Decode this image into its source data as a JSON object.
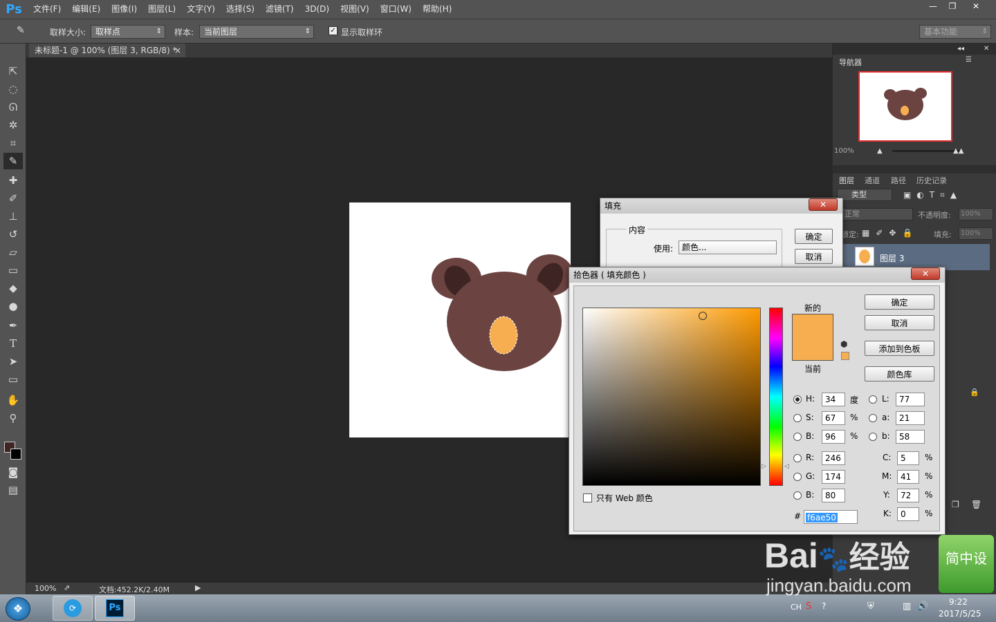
{
  "app": {
    "logo": "Ps"
  },
  "menu": [
    "文件(F)",
    "编辑(E)",
    "图像(I)",
    "图层(L)",
    "文字(Y)",
    "选择(S)",
    "滤镜(T)",
    "3D(D)",
    "视图(V)",
    "窗口(W)",
    "帮助(H)"
  ],
  "window_buttons": {
    "minimize": "—",
    "restore": "❐",
    "close": "✕"
  },
  "options": {
    "sample_size_label": "取样大小:",
    "sample_size_value": "取样点",
    "sample_label": "样本:",
    "sample_value": "当前图层",
    "show_ring_label": "显示取样环",
    "workspace_value": "基本功能"
  },
  "doc_tab": {
    "title": "未标题-1 @ 100% (图层 3, RGB/8) *",
    "close": "×"
  },
  "status": {
    "zoom": "100%",
    "doc_info": "文档:452.2K/2.40M"
  },
  "navigator": {
    "title": "导航器",
    "zoom": "100%"
  },
  "layers_panel": {
    "tabs": [
      "图层",
      "通道",
      "路径",
      "历史记录"
    ],
    "filter_label": "类型",
    "blend_mode": "正常",
    "opacity_label": "不透明度:",
    "opacity_value": "100%",
    "lock_label": "锁定:",
    "fill_label": "填充:",
    "fill_value": "100%",
    "layer_name": "图层 3"
  },
  "fill_dialog": {
    "title": "填充",
    "content_group": "内容",
    "use_label": "使用:",
    "use_value": "颜色...",
    "ok": "确定",
    "cancel": "取消"
  },
  "color_picker": {
    "title": "拾色器 ( 填充颜色 )",
    "new_label": "新的",
    "current_label": "当前",
    "ok": "确定",
    "cancel": "取消",
    "add_swatch": "添加到色板",
    "color_library": "颜色库",
    "web_only": "只有 Web 颜色",
    "new_color": "#f6ae50",
    "current_color": "#f6ae50",
    "hsb": {
      "H": "34",
      "H_unit": "度",
      "S": "67",
      "S_unit": "%",
      "B": "96",
      "B_unit": "%"
    },
    "rgb": {
      "R": "246",
      "G": "174",
      "B": "80"
    },
    "lab": {
      "L": "77",
      "a": "21",
      "b": "58"
    },
    "cmyk": {
      "C": "5",
      "M": "41",
      "Y": "72",
      "K": "0",
      "unit": "%"
    },
    "hex_label": "#",
    "hex": "f6ae50",
    "labels": {
      "H": "H:",
      "S": "S:",
      "B": "B:",
      "R": "R:",
      "G": "G:",
      "B2": "B:",
      "L": "L:",
      "a": "a:",
      "b": "b:",
      "C": "C:",
      "M": "M:",
      "Y": "Y:",
      "K": "K:"
    }
  },
  "colors": {
    "bear_dark": "#6b4340",
    "bear_ear": "#3e2523",
    "bear_snout": "#f6ae50",
    "hue_base": "#ff9a00"
  },
  "taskbar": {
    "lang": "CH",
    "time": "9:22",
    "date": "2017/5/25"
  },
  "watermark": {
    "brand": "Bai",
    "brand2": "经验",
    "url": "jingyan.baidu.com",
    "badge": "简中设"
  }
}
